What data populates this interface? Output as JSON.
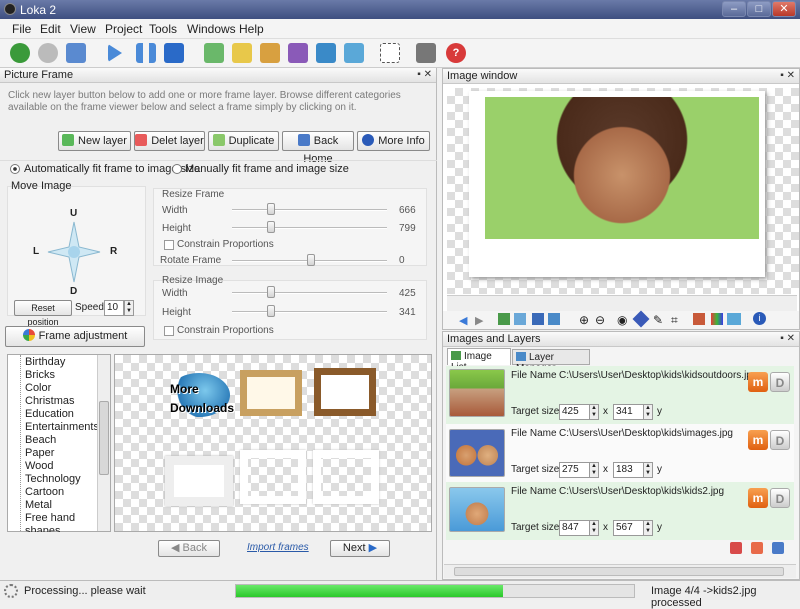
{
  "window": {
    "title": "Loka 2"
  },
  "menu": [
    "File",
    "Edit",
    "View",
    "Project",
    "Tools",
    "Windows",
    "Help"
  ],
  "picture_frame": {
    "title": "Picture Frame",
    "hint": "Click new layer button below to add one or more frame layer. Browse different categories available on the frame viewer below and select a frame simply by clicking on it.",
    "buttons": {
      "new_layer": "New layer",
      "delete_layer": "Delet layer",
      "duplicate": "Duplicate",
      "back_home": "Back Home",
      "more_info": "More Info"
    },
    "radio_auto": "Automatically fit frame to image size",
    "radio_manual": "Manually fit frame and image size",
    "move_image": "Move Image",
    "dir": {
      "up": "U",
      "left": "L",
      "right": "R",
      "down": "D"
    },
    "reset_position": "Reset position",
    "speed_label": "Speed:",
    "speed_value": "10",
    "frame_adjustment": "Frame adjustment",
    "resize_frame": {
      "title": "Resize Frame",
      "width_label": "Width",
      "width_value": "666",
      "height_label": "Height",
      "height_value": "799",
      "constrain": "Constrain Proportions",
      "rotate_label": "Rotate Frame",
      "rotate_value": "0"
    },
    "resize_image": {
      "title": "Resize Image",
      "width_label": "Width",
      "width_value": "425",
      "height_label": "Height",
      "height_value": "341",
      "constrain": "Constrain Proportions"
    }
  },
  "categories": [
    "Birthday",
    "Bricks",
    "Color",
    "Christmas",
    "Education",
    "Entertainments",
    "Beach",
    "Paper",
    "Wood",
    "Technology",
    "Cartoon",
    "Metal",
    "Free hand",
    "shapes"
  ],
  "frame_viewer": {
    "more_downloads_1": "More",
    "more_downloads_2": "Downloads"
  },
  "nav": {
    "back": "Back",
    "import": "Import frames",
    "next": "Next"
  },
  "image_window": {
    "title": "Image window"
  },
  "images_layers": {
    "title": "Images and Layers",
    "tab_list": "Image List",
    "tab_layers": "Layer Manager",
    "file_label": "File Name",
    "target_label": "Target size",
    "x_sep": "x",
    "y_sep": "y",
    "rows": [
      {
        "file": "C:\\Users\\User\\Desktop\\kids\\kidsoutdoors.jpeg",
        "w": "425",
        "h": "341"
      },
      {
        "file": "C:\\Users\\User\\Desktop\\kids\\images.jpg",
        "w": "275",
        "h": "183"
      },
      {
        "file": "C:\\Users\\User\\Desktop\\kids\\kids2.jpg",
        "w": "847",
        "h": "567"
      }
    ]
  },
  "status": {
    "left": "Processing... please wait",
    "progress": 0.67,
    "right": "Image 4/4 ->kids2.jpg processed"
  }
}
